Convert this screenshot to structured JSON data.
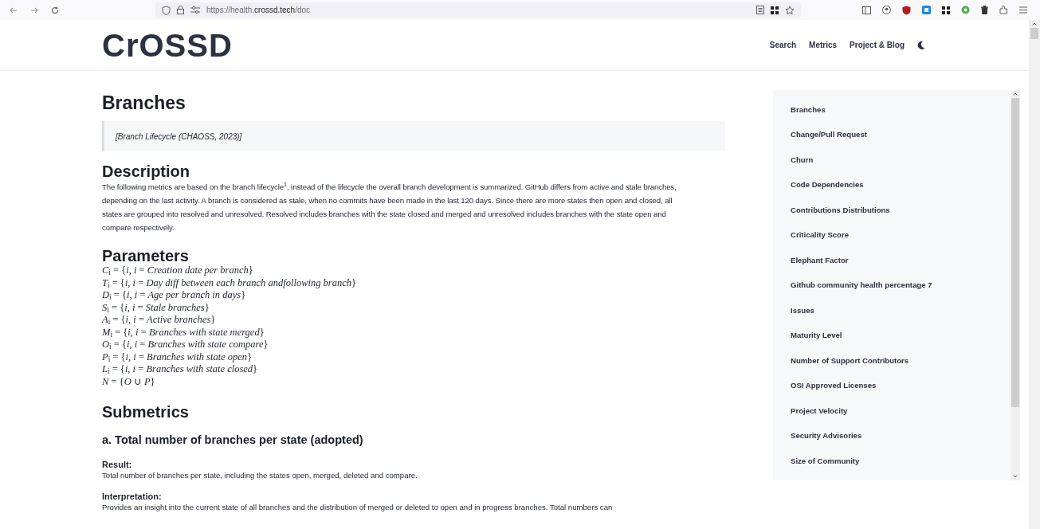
{
  "browser": {
    "url_prefix": "https://health.",
    "url_domain": "crossd.tech",
    "url_path": "/doc"
  },
  "header": {
    "logo": "CrOSSD",
    "nav": [
      "Search",
      "Metrics",
      "Project & Blog"
    ]
  },
  "article": {
    "title": "Branches",
    "quote": "[Branch Lifecycle (CHAOSS, 2023)]",
    "description_heading": "Description",
    "description": "The following metrics are based on the branch lifecycle$^{1}$, instead of the lifecycle the overall branch development is summarized. GitHub differs from active and stale branches, depending on the last activity. A branch is considered as stale, when no commits have been made in the last 120 days. Since there are more states then open and closed, all states are grouped into resolved and unresolved. Resolved includes branches with the state closed and merged and unresolved includes branches with the state open and compare respectively.",
    "parameters_heading": "Parameters",
    "parameters": [
      "*C*$_{i}$ = {*i*, *i* = *Creation date per branch*}",
      "*T*$_{i}$ = {*i*, *i* = *Day diff between each branch andfollowing branch*}",
      "*D*$_{i}$ = {*i*, *i* = *Age per branch in days*}",
      "*S*$_{i}$ = {*i*, *i* = *Stale branches*}",
      "*A*$_{i}$ = {*i*, *i* = *Active branches*}",
      "*M*$_{i}$ = {*i*, *i* = *Branches with state merged*}",
      "*O*$_{i}$ = {*i*, *i* = *Branches with state compare*}",
      "*P*$_{i}$ = {*i*, *i* = *Branches with state open*}",
      "*L*$_{i}$ = {*i*, *i* = *Branches with state closed*}",
      "*N* = {*O* ∪ *P*}"
    ],
    "submetrics_heading": "Submetrics",
    "submetric_title": "a. Total number of branches per state (adopted)",
    "result_heading": "Result:",
    "result": "Total number of branches per state, including the states open, merged, deleted and compare.",
    "interpretation_heading": "Interpretation:",
    "interpretation": "Provides an insight into the current state of all branches and the distribution of merged or deleted to open and in progress branches. Total numbers can"
  },
  "sidebar": {
    "items": [
      "Branches",
      "Change/Pull Request",
      "Churn",
      "Code Dependencies",
      "Contributions Distributions",
      "Criticality Score",
      "Elephant Factor",
      "Github community health percentage 7",
      "Issues",
      "Maturity Level",
      "Number of Support Contributors",
      "OSI Approved Licenses",
      "Project Velocity",
      "Security Advisories",
      "Size of Community"
    ]
  }
}
